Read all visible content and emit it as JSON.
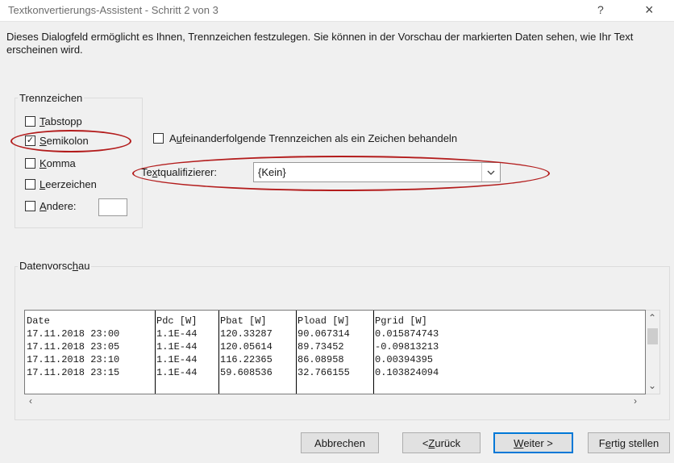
{
  "window": {
    "title": "Textkonvertierungs-Assistent - Schritt 2 von 3",
    "help_label": "?",
    "close_label": "×"
  },
  "description": "Dieses Dialogfeld ermöglicht es Ihnen, Trennzeichen festzulegen. Sie können in der Vorschau der markierten Daten sehen, wie Ihr Text erscheinen wird.",
  "delimiters": {
    "group_label": "Trennzeichen",
    "options": [
      {
        "label_pre": "",
        "label_u": "T",
        "label_post": "abstopp",
        "checked": false
      },
      {
        "label_pre": "",
        "label_u": "S",
        "label_post": "emikolon",
        "checked": true
      },
      {
        "label_pre": "",
        "label_u": "K",
        "label_post": "omma",
        "checked": false
      },
      {
        "label_pre": "",
        "label_u": "L",
        "label_post": "eerzeichen",
        "checked": false
      },
      {
        "label_pre": "",
        "label_u": "A",
        "label_post": "ndere:",
        "checked": false
      }
    ],
    "other_value": ""
  },
  "consecutive": {
    "label_pre": "A",
    "label_u": "u",
    "label_post": "feinanderfolgende Trennzeichen als ein Zeichen behandeln",
    "checked": false
  },
  "text_qualifier": {
    "label_pre": "Te",
    "label_u": "x",
    "label_post": "tqualifizierer:",
    "value": "{Kein}"
  },
  "preview": {
    "group_label_pre": "Datenvorsc",
    "group_label_u": "h",
    "group_label_post": "au",
    "columns": [
      "Date",
      "Pdc [W]",
      "Pbat [W]",
      "Pload [W]",
      "Pgrid [W]"
    ],
    "rows": [
      [
        "17.11.2018 23:00",
        "1.1E-44",
        "120.33287",
        "90.067314",
        "0.015874743"
      ],
      [
        "17.11.2018 23:05",
        "1.1E-44",
        "120.05614",
        "89.73452",
        "-0.09813213"
      ],
      [
        "17.11.2018 23:10",
        "1.1E-44",
        "116.22365",
        "86.08958",
        "0.00394395"
      ],
      [
        "17.11.2018 23:15",
        "1.1E-44",
        "59.608536",
        "32.766155",
        "0.103824094"
      ]
    ]
  },
  "buttons": {
    "cancel": "Abbrechen",
    "back_pre": "< ",
    "back_u": "Z",
    "back_post": "urück",
    "next_pre": "",
    "next_u": "W",
    "next_post": "eiter >",
    "finish_pre": "F",
    "finish_u": "e",
    "finish_post": "rtig stellen"
  },
  "colors": {
    "annotation": "#b31c1c",
    "default_button_border": "#0078d7"
  }
}
